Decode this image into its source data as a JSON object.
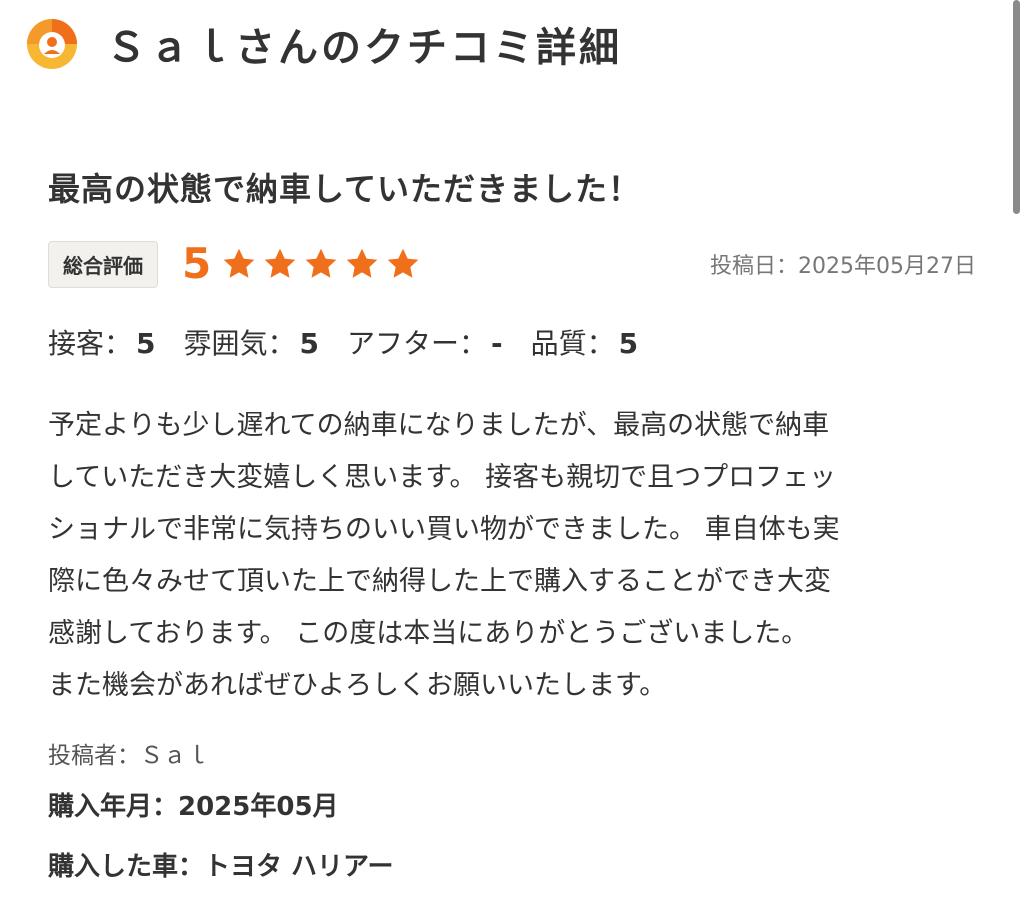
{
  "header": {
    "title": "Ｓａｌさんのクチコミ詳細",
    "logo_icon": "map-pin-logo-icon",
    "brand_colors": [
      "#f06f1a",
      "#f7b733"
    ]
  },
  "review": {
    "title": "最高の状態で納車していただきました！",
    "overall_label": "総合評価",
    "overall_score": "5",
    "stars": 5,
    "star_color": "#f06f1a",
    "post_date_label": "投稿日：",
    "post_date": "2025年05月27日",
    "sub_ratings": [
      {
        "label": "接客：",
        "value": "5"
      },
      {
        "label": "雰囲気：",
        "value": "5"
      },
      {
        "label": "アフター：",
        "value": "-"
      },
      {
        "label": "品質：",
        "value": "5"
      }
    ],
    "body_lines": [
      "予定よりも少し遅れての納車になりましたが、最高の状態で納車",
      "していただき大変嬉しく思います。 接客も親切で且つプロフェッ",
      "ショナルで非常に気持ちのいい買い物ができました。 車自体も実",
      "際に色々みせて頂いた上で納得した上で購入することができ大変",
      "感謝しております。 この度は本当にありがとうございました。",
      "また機会があればぜひよろしくお願いいたします。"
    ]
  },
  "meta": {
    "author": "投稿者：Ｓａｌ",
    "purchase_date": "購入年月：2025年05月",
    "purchase_car": "購入した車：トヨタ ハリアー"
  }
}
